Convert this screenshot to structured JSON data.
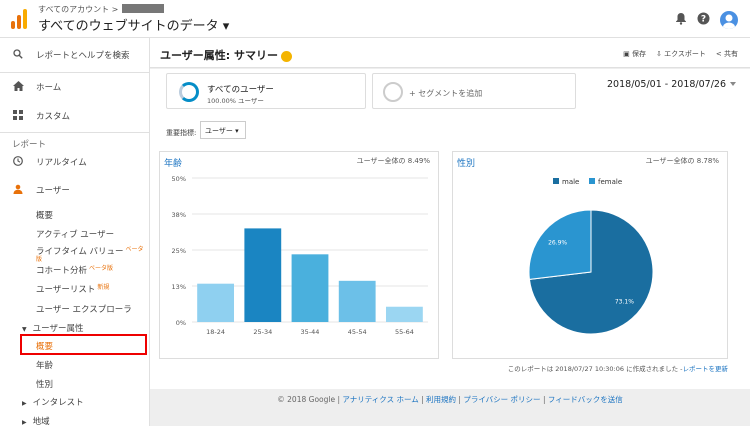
{
  "header": {
    "account_small": "すべてのアカウント >",
    "account_title": "すべてのウェブサイトのデータ ▾"
  },
  "sidebar": {
    "search": "レポートとヘルプを検索",
    "home": "ホーム",
    "custom": "カスタム",
    "reports_header": "レポート",
    "realtime": "リアルタイム",
    "audience": "ユーザー",
    "sub_overview": "概要",
    "sub_active_users": "アクティブ ユーザー",
    "sub_lifetime_value": "ライフタイム バリュー",
    "sub_lifetime_badge": "ベータ版",
    "sub_cohort": "コホート分析",
    "sub_cohort_badge": "ベータ版",
    "sub_user_list": "ユーザーリスト",
    "sub_user_list_badge": "新規",
    "sub_user_explorer": "ユーザー エクスプローラ",
    "demographics": "ユーザー属性",
    "demo_overview": "概要",
    "demo_age": "年齢",
    "demo_gender": "性別",
    "interests": "インタレスト",
    "geo": "地域"
  },
  "page": {
    "title": "ユーザー属性: サマリー",
    "save": "保存",
    "export": "エクスポート",
    "share": "共有",
    "segment_label": "すべてのユーザー",
    "segment_sub": "100.00% ユーザー",
    "add_segment": "+ セグメントを追加",
    "date_range": "2018/05/01 - 2018/07/26",
    "metric_label": "重要指標:",
    "metric_value": "ユーザー ▾"
  },
  "age_panel": {
    "title": "年齢",
    "pct": "ユーザー全体の 8.49%"
  },
  "gender_panel": {
    "title": "性別",
    "pct": "ユーザー全体の 8.78%"
  },
  "chart_data": [
    {
      "type": "bar",
      "categories": [
        "18-24",
        "25-34",
        "35-44",
        "45-54",
        "55-64"
      ],
      "values": [
        13.3,
        32.5,
        23.5,
        14.3,
        5.3
      ],
      "yticks": [
        "0%",
        "13%",
        "25%",
        "38%",
        "50%"
      ],
      "ylim": [
        0,
        50
      ],
      "colors": [
        "#8fd0f0",
        "#1a85c2",
        "#4ab0dd",
        "#6cc0e8",
        "#9bd6f2"
      ]
    },
    {
      "type": "pie",
      "categories": [
        "male",
        "female"
      ],
      "values": [
        73.1,
        26.9
      ],
      "labels": [
        "73.1%",
        "26.9%"
      ],
      "colors": [
        "#1a6ea0",
        "#2a95d0"
      ]
    }
  ],
  "footer": {
    "note": "このレポートは 2018/07/27 10:30:06 に作成されました -",
    "refresh": "レポートを更新",
    "copyright": "© 2018 Google |",
    "analytics_home": "アナリティクス ホーム",
    "terms": "利用規約",
    "privacy": "プライバシー ポリシー",
    "feedback": "フィードバックを送信"
  }
}
